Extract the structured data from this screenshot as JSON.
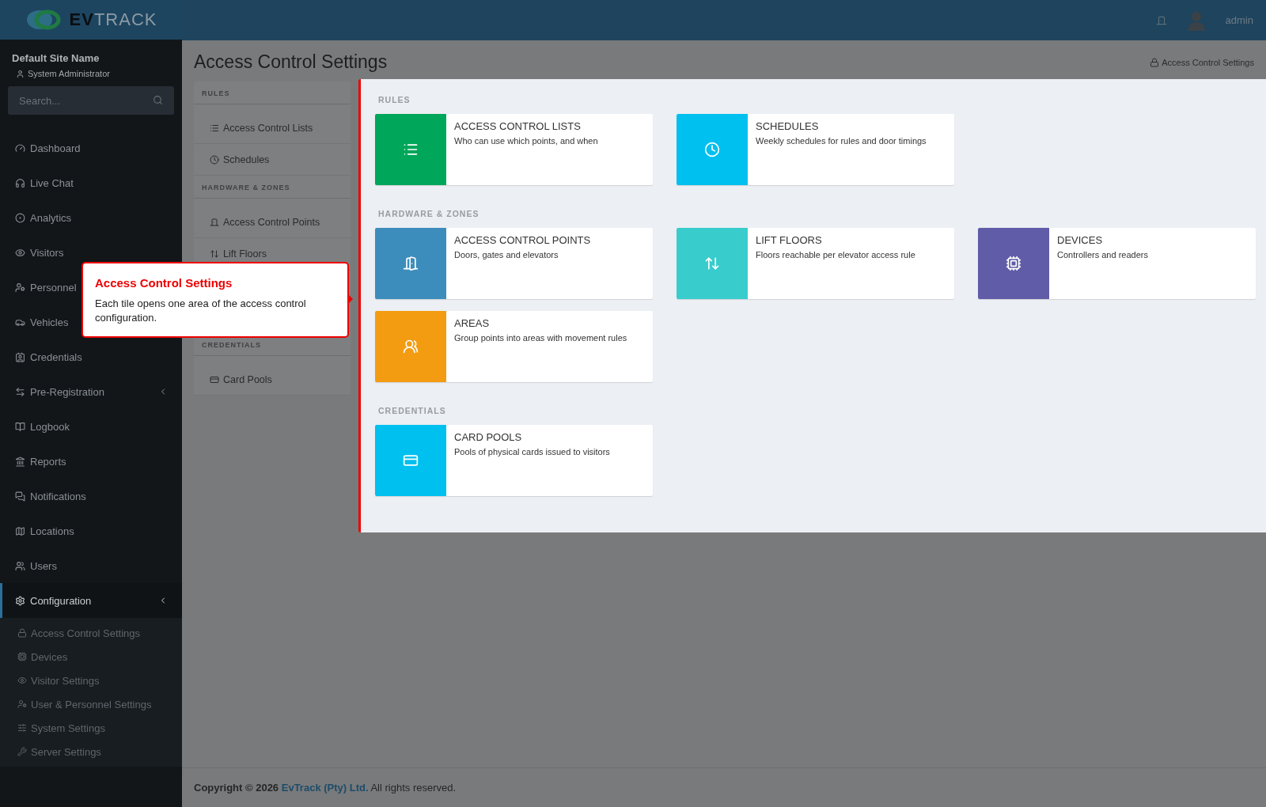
{
  "brand": {
    "name_bold": "EV",
    "name_light": "TRACK"
  },
  "topbar": {
    "user": "admin"
  },
  "site": {
    "name": "Default Site Name",
    "role": "System Administrator"
  },
  "search": {
    "placeholder": "Search..."
  },
  "nav": [
    {
      "label": "Dashboard",
      "kind": "link",
      "selected": false
    },
    {
      "label": "Live Chat",
      "kind": "link",
      "selected": false
    },
    {
      "label": "Analytics",
      "kind": "link",
      "selected": false
    },
    {
      "label": "Visitors",
      "kind": "link",
      "selected": false
    },
    {
      "label": "Personnel",
      "kind": "link",
      "selected": false
    },
    {
      "label": "Vehicles",
      "kind": "link",
      "selected": false
    },
    {
      "label": "Credentials",
      "kind": "link",
      "selected": false
    },
    {
      "label": "Pre-Registration",
      "kind": "menu",
      "selected": false
    },
    {
      "label": "Logbook",
      "kind": "link",
      "selected": false
    },
    {
      "label": "Reports",
      "kind": "link",
      "selected": false
    },
    {
      "label": "Notifications",
      "kind": "link",
      "selected": false
    },
    {
      "label": "Locations",
      "kind": "link",
      "selected": false
    },
    {
      "label": "Users",
      "kind": "link",
      "selected": false
    },
    {
      "label": "Configuration",
      "kind": "menu",
      "selected": true,
      "children": [
        {
          "label": "Access Control Settings"
        },
        {
          "label": "Devices"
        },
        {
          "label": "Visitor Settings"
        },
        {
          "label": "User & Personnel Settings"
        },
        {
          "label": "System Settings"
        },
        {
          "label": "Server Settings"
        }
      ]
    }
  ],
  "page": {
    "title": "Access Control Settings",
    "breadcrumb": "Access Control Settings"
  },
  "side_menu": [
    {
      "heading": "RULES",
      "items": [
        "Access Control Lists",
        "Schedules"
      ]
    },
    {
      "heading": "HARDWARE & ZONES",
      "items": [
        "Access Control Points",
        "Lift Floors"
      ]
    },
    {
      "heading": "CREDENTIALS",
      "items": [
        "Card Pools"
      ]
    }
  ],
  "sections": [
    {
      "heading": "RULES",
      "tiles": [
        {
          "title": "ACCESS CONTROL LISTS",
          "text": "Who can use which points, and when",
          "color": "#00a65a"
        },
        {
          "title": "SCHEDULES",
          "text": "Weekly schedules for rules and door timings",
          "color": "#00c0ef"
        }
      ]
    },
    {
      "heading": "HARDWARE & ZONES",
      "tiles": [
        {
          "title": "ACCESS CONTROL POINTS",
          "text": "Doors, gates and elevators",
          "color": "#3c8dbc"
        },
        {
          "title": "LIFT FLOORS",
          "text": "Floors reachable per elevator access rule",
          "color": "#39cccc"
        },
        {
          "title": "DEVICES",
          "text": "Controllers and readers",
          "color": "#605ca8"
        },
        {
          "title": "AREAS",
          "text": "Group points into areas with movement rules",
          "color": "#f39c12"
        }
      ]
    },
    {
      "heading": "CREDENTIALS",
      "tiles": [
        {
          "title": "CARD POOLS",
          "text": "Pools of physical cards issued to visitors",
          "color": "#00c0ef"
        }
      ]
    }
  ],
  "tour": {
    "title": "Access Control Settings",
    "text": "Each tile opens one area of the access control configuration."
  },
  "footer": {
    "text": "**Copyright © 2026** ",
    "link": "EvTrack (Pty) Ltd.",
    "suffix": " All rights reserved."
  }
}
